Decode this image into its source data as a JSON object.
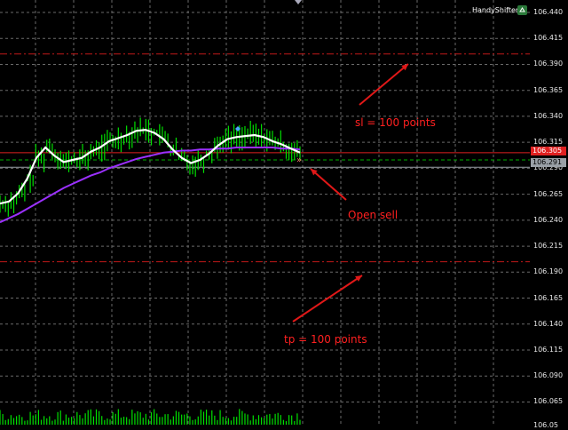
{
  "brand": {
    "name": "HandyShifter",
    "icon": "recycle-icon"
  },
  "colors": {
    "background": "#000000",
    "grid": "#6a6a6a",
    "candle_green": "#00e000",
    "ma_fast": "#ffffff",
    "ma_slow": "#9b30ff",
    "sl_line": "#c01818",
    "tp_line": "#c01818",
    "bid_line": "#9aa0a6",
    "ask_line": "#00b000",
    "annotation": "#ff2020"
  },
  "price_axis": {
    "ticks": [
      "106.440",
      "106.415",
      "106.390",
      "106.365",
      "106.340",
      "106.315",
      "106.290",
      "106.265",
      "106.240",
      "106.215",
      "106.190",
      "106.165",
      "106.140",
      "106.115",
      "106.090",
      "106.065"
    ],
    "bottom_label": "106.05"
  },
  "price_tags": {
    "red_line": "106.305",
    "bid": "106.291"
  },
  "annotations": {
    "sl": "sl = 100 points",
    "open": "Open sell",
    "tp": "tp = 100 points"
  },
  "chart_data": {
    "type": "candlestick",
    "ylim": [
      106.05,
      106.44
    ],
    "levels": {
      "stop_loss": 106.4,
      "take_profit": 106.2,
      "order_line": 106.305,
      "ask": 106.298,
      "bid": 106.291
    },
    "ma_fast": [
      106.256,
      106.258,
      106.266,
      106.28,
      106.3,
      106.31,
      106.302,
      106.296,
      106.298,
      106.3,
      106.306,
      106.31,
      106.316,
      106.319,
      106.322,
      106.326,
      106.327,
      106.324,
      106.318,
      106.308,
      106.3,
      106.295,
      106.298,
      106.304,
      106.312,
      106.318,
      106.32,
      106.321,
      106.322,
      106.32,
      106.316,
      106.313,
      106.309,
      106.305
    ],
    "ma_slow": [
      106.238,
      106.242,
      106.246,
      106.251,
      106.256,
      106.261,
      106.266,
      106.271,
      106.275,
      106.279,
      106.283,
      106.286,
      106.29,
      106.293,
      106.296,
      106.299,
      106.301,
      106.303,
      106.305,
      106.306,
      106.307,
      106.307,
      106.308,
      106.308,
      106.309,
      106.309,
      106.31,
      106.31,
      106.31,
      106.31,
      106.31,
      106.309,
      106.309,
      106.308
    ]
  }
}
